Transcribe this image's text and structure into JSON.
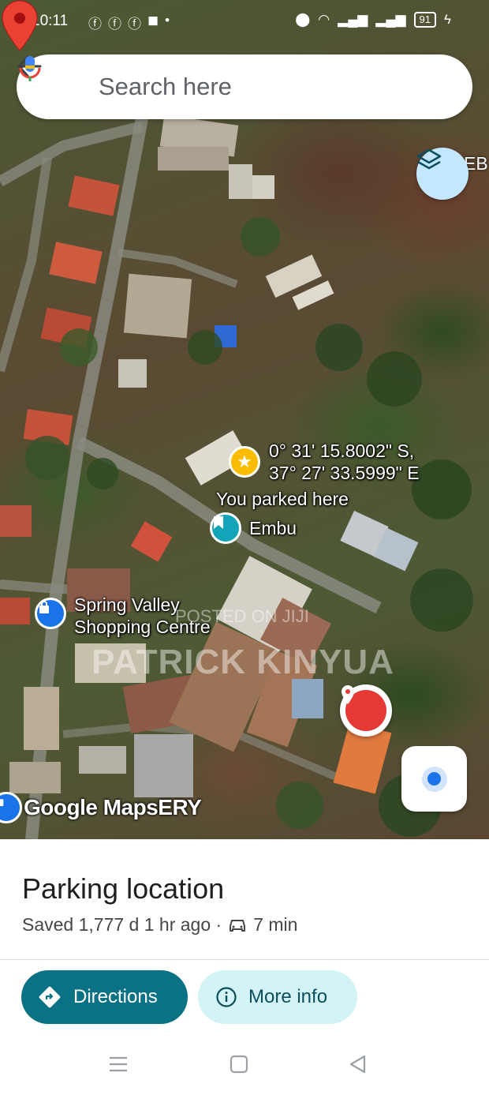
{
  "status_bar": {
    "time": "10:11",
    "left_icons": [
      "facebook-icon",
      "facebook-icon",
      "facebook-icon",
      "facebook-icon",
      "dot"
    ],
    "right_icons": [
      "location-icon",
      "wifi-icon",
      "signal-icon",
      "signal-icon"
    ],
    "battery": "91"
  },
  "search": {
    "placeholder": "Search here"
  },
  "map": {
    "coordinates_line1": "0° 31' 15.8002\" S,",
    "coordinates_line2": "37° 27' 33.5999\" E",
    "parked_label": "You parked here",
    "place_embu": "Embu",
    "place_shop_line1": "Spring Valley",
    "place_shop_line2": "Shopping Centre",
    "watermark": "PATRICK KINYUA",
    "watermark_small": "POSTED ON JIJI",
    "edge_label": "EB",
    "logo": "Google Maps",
    "logo_suffix": "ERY"
  },
  "sheet": {
    "title": "Parking location",
    "saved": "Saved 1,777 d 1 hr ago ·",
    "drive_time": "7 min",
    "directions_label": "Directions",
    "more_info_label": "More info"
  },
  "colors": {
    "accent": "#0b7285",
    "accent_light": "#d3f3f7",
    "pin_red": "#e53935",
    "location_blue": "#1a73e8"
  }
}
